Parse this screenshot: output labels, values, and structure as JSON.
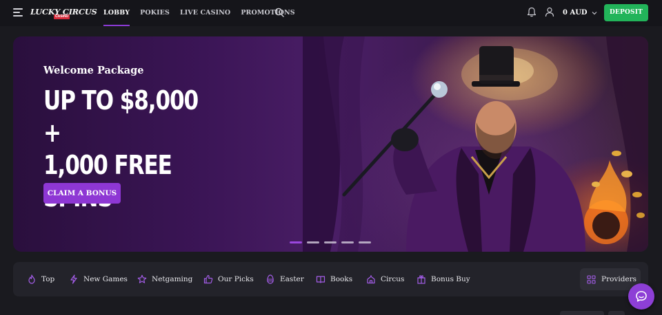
{
  "header": {
    "logo_text": "LUCKY CIRCUS",
    "logo_tag": "CASINO",
    "nav": [
      {
        "label": "LOBBY",
        "active": true
      },
      {
        "label": "POKIES",
        "active": false
      },
      {
        "label": "LIVE CASINO",
        "active": false
      },
      {
        "label": "PROMOTIONS",
        "active": false
      }
    ],
    "balance": "0 AUD",
    "deposit_label": "DEPOSIT",
    "icons": {
      "menu": "hamburger-icon",
      "search": "search-icon",
      "bell": "bell-icon",
      "user": "user-icon"
    }
  },
  "hero": {
    "welcome": "Welcome Package",
    "headline_lines": [
      "UP TO $8,000 +",
      "1,000 FREE",
      "SPINS"
    ],
    "cta_label": "CLAIM A BONUS",
    "slides_total": 5,
    "active_slide": 1
  },
  "categories": [
    {
      "label": "Top",
      "icon": "flame-icon"
    },
    {
      "label": "New Games",
      "icon": "lightning-icon"
    },
    {
      "label": "Netgaming",
      "icon": "star-icon"
    },
    {
      "label": "Our Picks",
      "icon": "thumbs-up-icon"
    },
    {
      "label": "Easter",
      "icon": "egg-icon"
    },
    {
      "label": "Books",
      "icon": "book-icon"
    },
    {
      "label": "Circus",
      "icon": "circus-tent-icon"
    },
    {
      "label": "Bonus Buy",
      "icon": "gift-icon"
    }
  ],
  "providers_label": "Providers",
  "colors": {
    "accent": "#8e37d4",
    "deposit": "#22b45a",
    "background": "#1a1a1f",
    "icon_purple": "#a45de8"
  }
}
